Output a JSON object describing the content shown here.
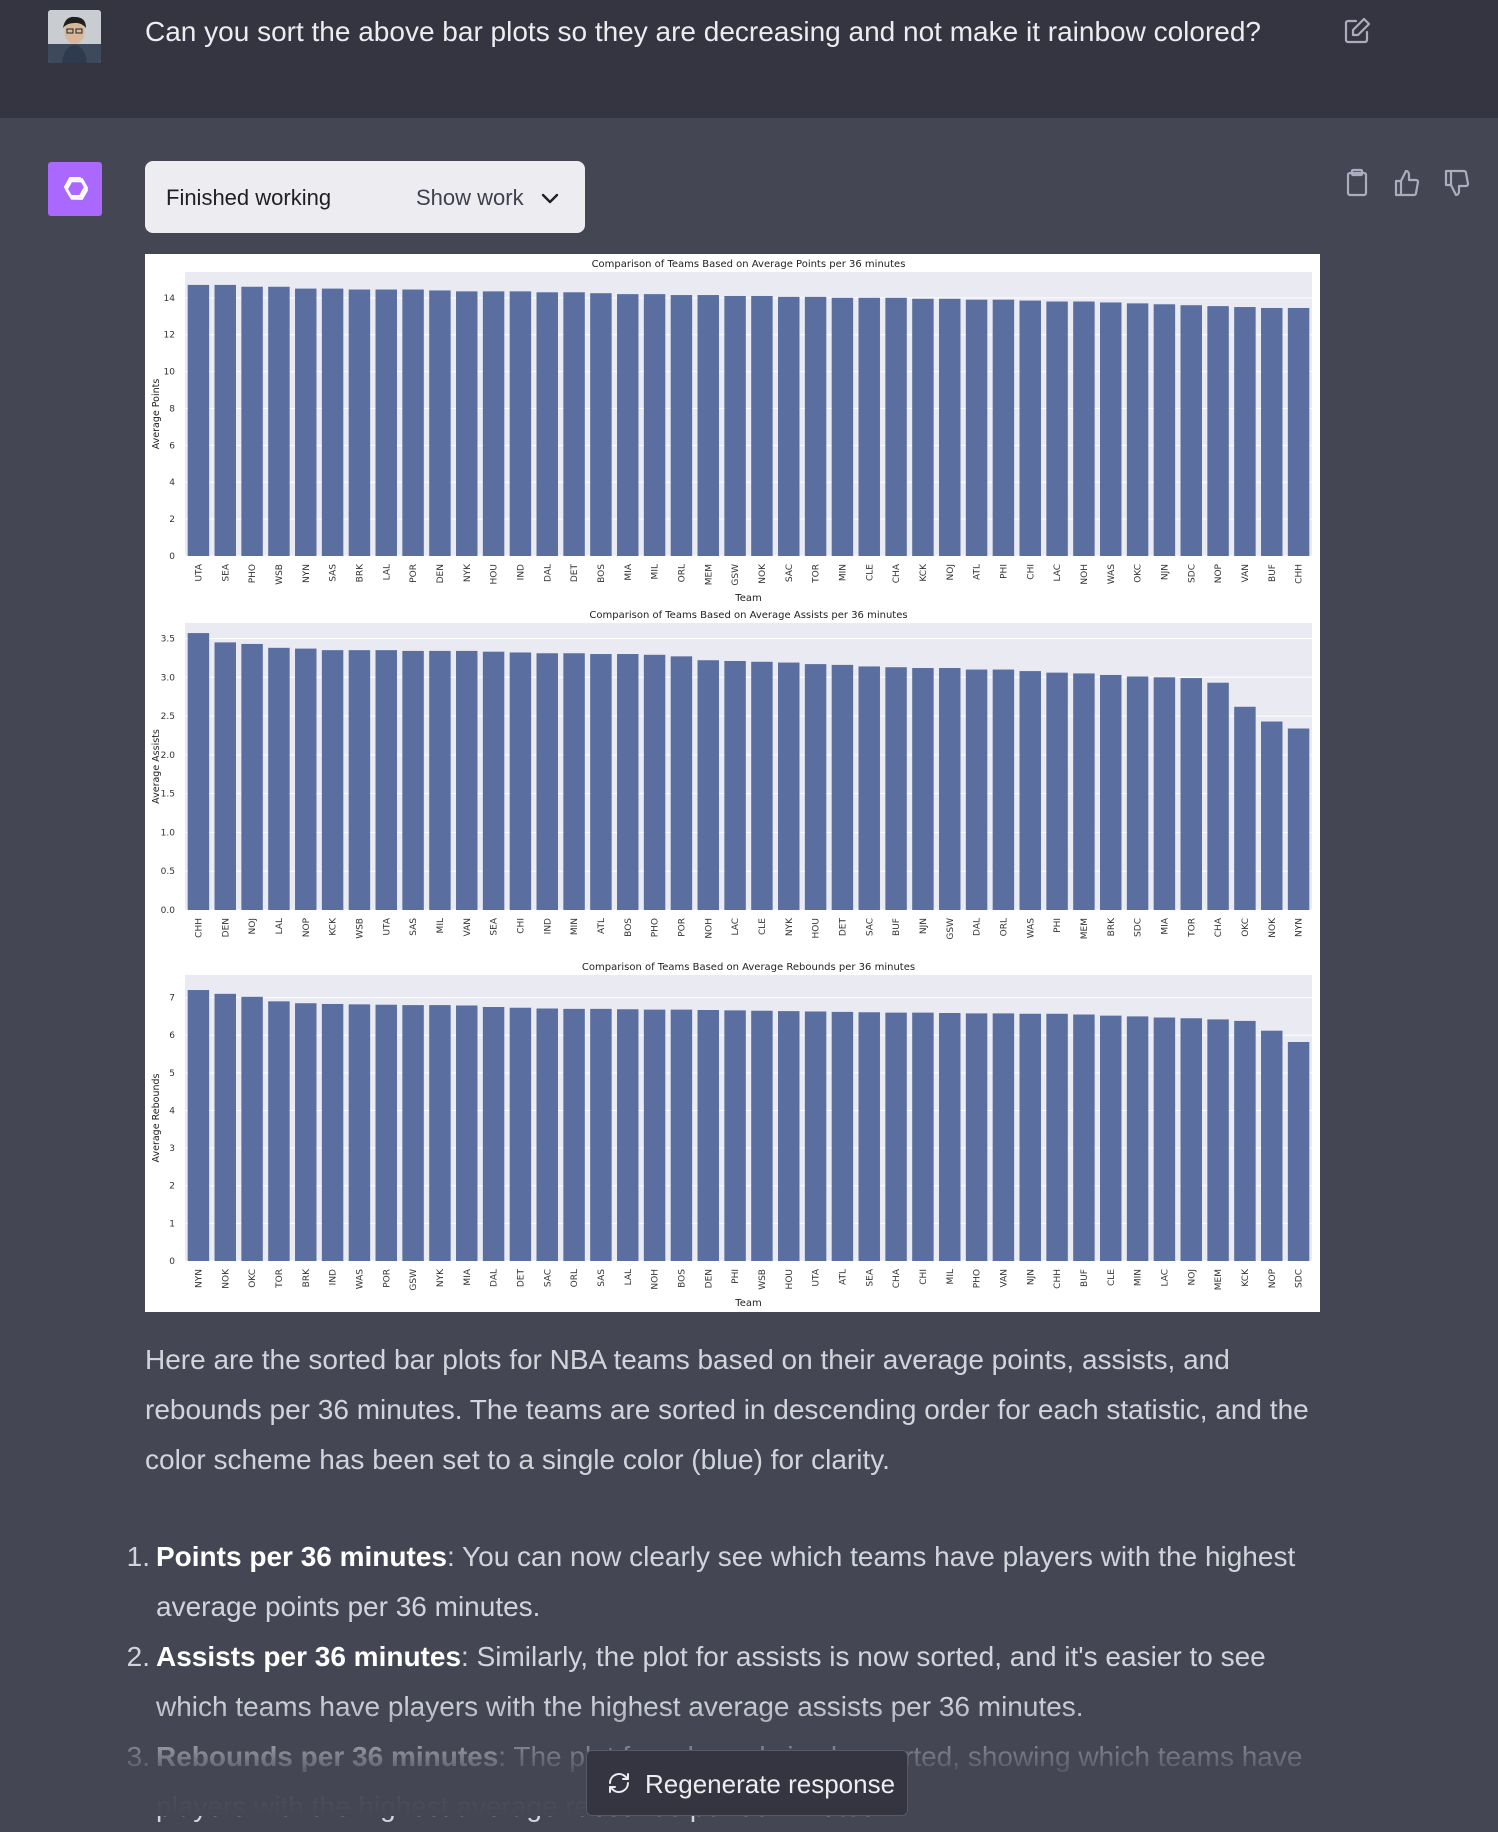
{
  "conversation": {
    "user_message": "Can you sort the above bar plots so they are decreasing and not make it rainbow colored?",
    "work_status": "Finished working",
    "show_work_label": "Show work",
    "response_intro": "Here are the sorted bar plots for NBA teams based on their average points, assists, and rebounds per 36 minutes. The teams are sorted in descending order for each statistic, and the color scheme has been set to a single color (blue) for clarity.",
    "list_items": [
      {
        "num": "1.",
        "title": "Points per 36 minutes",
        "text": ": You can now clearly see which teams have players with the highest average points per 36 minutes."
      },
      {
        "num": "2.",
        "title": "Assists per 36 minutes",
        "text": ": Similarly, the plot for assists is now sorted, and it's easier to see which teams have players with the highest average assists per 36 minutes."
      },
      {
        "num": "3.",
        "title": "Rebounds per 36 minutes",
        "text": ": The plot for rebounds is also sorted, showing which teams have players with the highest average rebounds per 36 minutes."
      }
    ],
    "regenerate_label": "Regenerate response"
  },
  "icons": {
    "edit": "edit-icon",
    "copy": "clipboard-icon",
    "thumbs_up": "thumbs-up-icon",
    "thumbs_down": "thumbs-down-icon",
    "chevron": "chevron-down-icon",
    "regenerate": "refresh-icon"
  },
  "colors": {
    "bar": "#5a6fa0",
    "plot_bg": "#eaeaf2",
    "assistant_logo": "#ab68ff"
  },
  "chart_data": [
    {
      "type": "bar",
      "title": "Comparison of Teams Based on Average Points per 36 minutes",
      "xlabel": "Team",
      "ylabel": "Average Points",
      "ylim": [
        0,
        15.4
      ],
      "yticks": [
        0,
        2,
        4,
        6,
        8,
        10,
        12,
        14
      ],
      "ytick_labels": [
        "0",
        "2",
        "4",
        "6",
        "8",
        "10",
        "12",
        "14"
      ],
      "categories": [
        "UTA",
        "SEA",
        "PHO",
        "WSB",
        "NYN",
        "SAS",
        "BRK",
        "LAL",
        "POR",
        "DEN",
        "NYK",
        "HOU",
        "IND",
        "DAL",
        "DET",
        "BOS",
        "MIA",
        "MIL",
        "ORL",
        "MEM",
        "GSW",
        "NOK",
        "SAC",
        "TOR",
        "MIN",
        "CLE",
        "CHA",
        "KCK",
        "NOJ",
        "ATL",
        "PHI",
        "CHI",
        "LAC",
        "NOH",
        "WAS",
        "OKC",
        "NJN",
        "SDC",
        "NOP",
        "VAN",
        "BUF",
        "CHH"
      ],
      "values": [
        14.7,
        14.7,
        14.6,
        14.6,
        14.5,
        14.5,
        14.45,
        14.45,
        14.45,
        14.4,
        14.35,
        14.35,
        14.35,
        14.3,
        14.3,
        14.25,
        14.2,
        14.2,
        14.15,
        14.15,
        14.1,
        14.1,
        14.05,
        14.05,
        14.0,
        14.0,
        14.0,
        13.95,
        13.95,
        13.9,
        13.9,
        13.85,
        13.8,
        13.8,
        13.75,
        13.7,
        13.65,
        13.6,
        13.55,
        13.5,
        13.45,
        13.45
      ]
    },
    {
      "type": "bar",
      "title": "Comparison of Teams Based on Average Assists per 36 minutes",
      "xlabel": "",
      "ylabel": "Average Assists",
      "ylim": [
        0,
        3.7
      ],
      "yticks": [
        0,
        0.5,
        1.0,
        1.5,
        2.0,
        2.5,
        3.0,
        3.5
      ],
      "ytick_labels": [
        "0.0",
        "0.5",
        "1.0",
        "1.5",
        "2.0",
        "2.5",
        "3.0",
        "3.5"
      ],
      "categories": [
        "CHH",
        "DEN",
        "NOJ",
        "LAL",
        "NOP",
        "KCK",
        "WSB",
        "UTA",
        "SAS",
        "MIL",
        "VAN",
        "SEA",
        "CHI",
        "IND",
        "MIN",
        "ATL",
        "BOS",
        "PHO",
        "POR",
        "NOH",
        "LAC",
        "CLE",
        "NYK",
        "HOU",
        "DET",
        "SAC",
        "BUF",
        "NJN",
        "GSW",
        "DAL",
        "ORL",
        "WAS",
        "PHI",
        "MEM",
        "BRK",
        "SDC",
        "MIA",
        "TOR",
        "CHA",
        "OKC",
        "NOK",
        "NYN"
      ],
      "values": [
        3.57,
        3.45,
        3.43,
        3.38,
        3.37,
        3.35,
        3.35,
        3.35,
        3.34,
        3.34,
        3.34,
        3.33,
        3.32,
        3.31,
        3.31,
        3.3,
        3.3,
        3.29,
        3.27,
        3.22,
        3.21,
        3.2,
        3.19,
        3.17,
        3.16,
        3.14,
        3.13,
        3.12,
        3.12,
        3.1,
        3.1,
        3.08,
        3.06,
        3.05,
        3.03,
        3.01,
        3.0,
        2.99,
        2.93,
        2.62,
        2.43,
        2.34
      ]
    },
    {
      "type": "bar",
      "title": "Comparison of Teams Based on Average Rebounds per 36 minutes",
      "xlabel": "Team",
      "ylabel": "Average Rebounds",
      "ylim": [
        0,
        7.6
      ],
      "yticks": [
        0,
        1,
        2,
        3,
        4,
        5,
        6,
        7
      ],
      "ytick_labels": [
        "0",
        "1",
        "2",
        "3",
        "4",
        "5",
        "6",
        "7"
      ],
      "categories": [
        "NYN",
        "NOK",
        "OKC",
        "TOR",
        "BRK",
        "IND",
        "WAS",
        "POR",
        "GSW",
        "NYK",
        "MIA",
        "DAL",
        "DET",
        "SAC",
        "ORL",
        "SAS",
        "LAL",
        "NOH",
        "BOS",
        "DEN",
        "PHI",
        "WSB",
        "HOU",
        "UTA",
        "ATL",
        "SEA",
        "CHA",
        "CHI",
        "MIL",
        "PHO",
        "VAN",
        "NJN",
        "CHH",
        "BUF",
        "CLE",
        "MIN",
        "LAC",
        "NOJ",
        "MEM",
        "KCK",
        "NOP",
        "SDC"
      ],
      "values": [
        7.2,
        7.1,
        7.02,
        6.9,
        6.85,
        6.83,
        6.82,
        6.81,
        6.8,
        6.8,
        6.79,
        6.75,
        6.73,
        6.71,
        6.7,
        6.7,
        6.69,
        6.68,
        6.68,
        6.67,
        6.66,
        6.65,
        6.64,
        6.63,
        6.62,
        6.61,
        6.6,
        6.6,
        6.59,
        6.58,
        6.58,
        6.57,
        6.57,
        6.55,
        6.52,
        6.5,
        6.47,
        6.45,
        6.42,
        6.38,
        6.12,
        5.82
      ]
    }
  ]
}
